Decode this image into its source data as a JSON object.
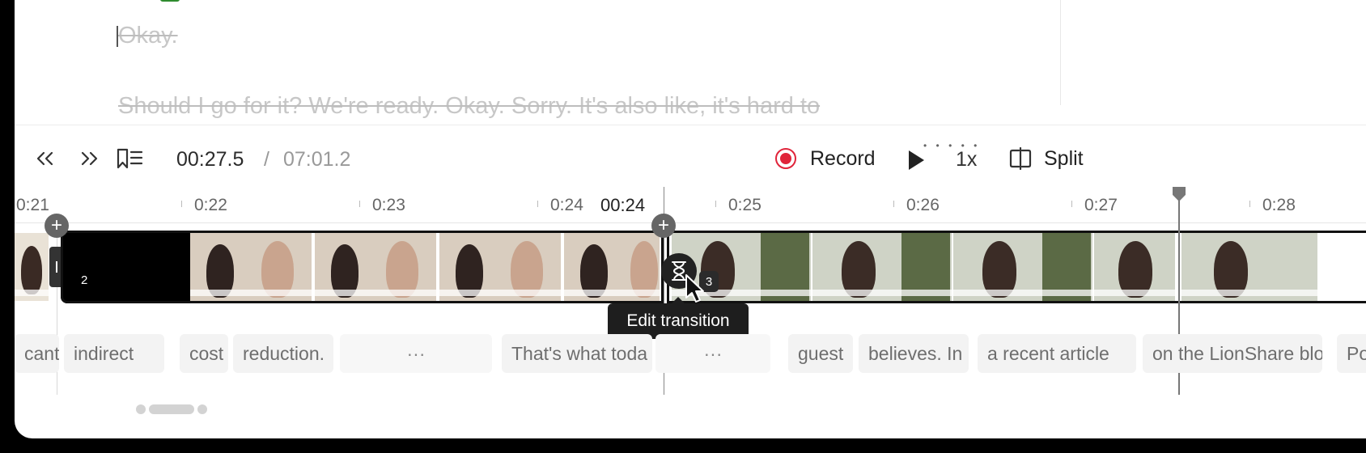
{
  "transcript": {
    "lines": [
      {
        "text": "Okay.",
        "state": "deleted"
      },
      {
        "text": "Should I go for it? We're ready. Okay. Sorry. It's also like, it's hard to",
        "state": "deleted"
      }
    ]
  },
  "toolbar": {
    "rewind_icon": "chevrons-left-icon",
    "forward_icon": "chevrons-right-icon",
    "bookmarks_icon": "bookmark-list-icon",
    "current_time": "00:27.5",
    "time_separator": "/",
    "total_time": "07:01.2",
    "record_label": "Record",
    "play_icon": "play-icon",
    "speed": "1x",
    "split_label": "Split",
    "drag_grip": "• • • • •"
  },
  "ruler": {
    "ticks": [
      "0:21",
      "0:22",
      "0:23",
      "0:24",
      "0:25",
      "0:26",
      "0:27",
      "0:28"
    ],
    "transition_marker": "00:24"
  },
  "clips": [
    {
      "number": "2"
    },
    {
      "number": "3"
    }
  ],
  "tooltip": {
    "text": "Edit transition"
  },
  "words": [
    "cant",
    "indirect",
    "cost",
    "reduction.",
    "···",
    "That's what toda",
    "···",
    "guest",
    "believes. In",
    "a recent article",
    "on the LionShare blo",
    "Pow"
  ],
  "colors": {
    "record": "#e0243a",
    "deleted_text": "#c7c7c7",
    "accent_green": "#2e8b2e"
  }
}
